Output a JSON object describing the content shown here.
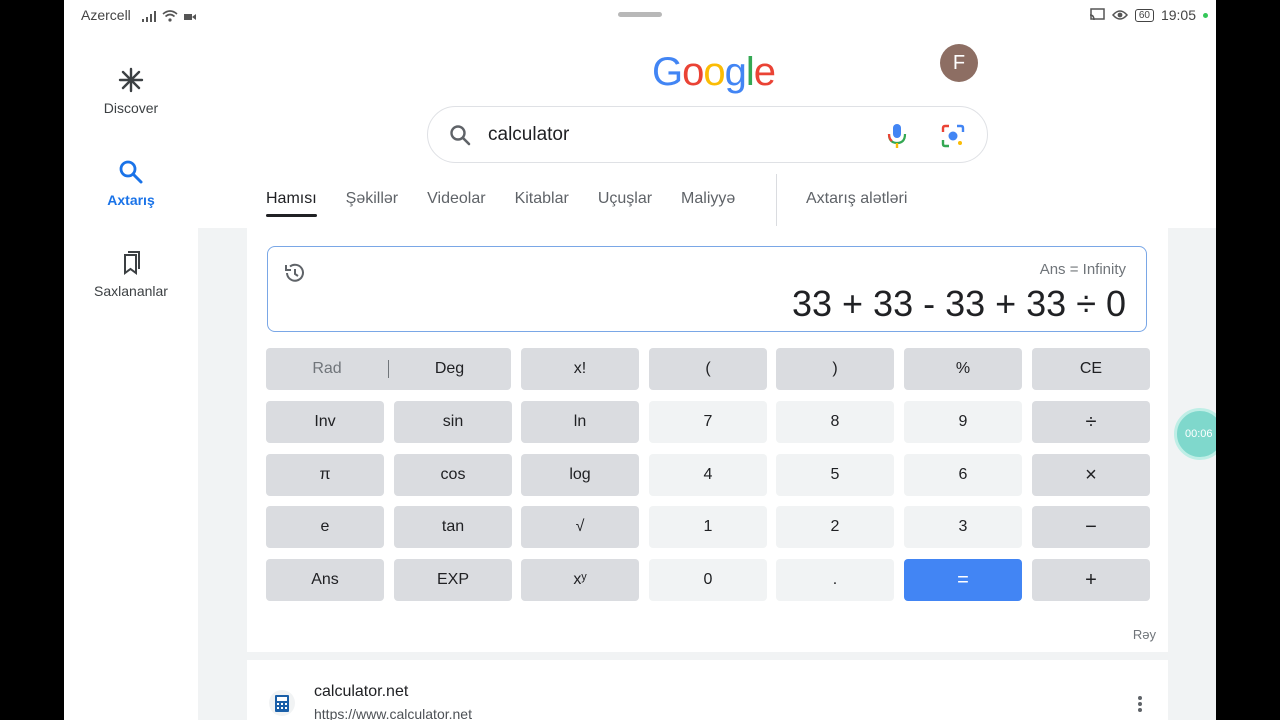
{
  "status_bar": {
    "carrier": "Azercell",
    "battery": "60",
    "time": "19:05"
  },
  "rail": [
    {
      "label": "Discover",
      "icon": "discover-icon"
    },
    {
      "label": "Axtarış",
      "icon": "search-icon",
      "active": true
    },
    {
      "label": "Saxlananlar",
      "icon": "saved-icon"
    }
  ],
  "header": {
    "logo_letters": [
      {
        "ch": "G",
        "color": "#4285f4"
      },
      {
        "ch": "o",
        "color": "#ea4335"
      },
      {
        "ch": "o",
        "color": "#fbbc05"
      },
      {
        "ch": "g",
        "color": "#4285f4"
      },
      {
        "ch": "l",
        "color": "#34a853"
      },
      {
        "ch": "e",
        "color": "#ea4335"
      }
    ],
    "avatar_letter": "F",
    "avatar_color": "#8d6e63"
  },
  "search": {
    "query": "calculator"
  },
  "tabs": [
    "Hamısı",
    "Şəkillər",
    "Videolar",
    "Kitablar",
    "Uçuşlar",
    "Maliyyə"
  ],
  "tools_label": "Axtarış alətləri",
  "calculator": {
    "ans": "Ans = Infinity",
    "expression": "33 + 33 - 33 + 33 ÷ 0",
    "rad_label": "Rad",
    "deg_label": "Deg",
    "keys": [
      {
        "label": "x!",
        "type": "fn",
        "name": "factorial-key"
      },
      {
        "label": "(",
        "type": "fn",
        "name": "open-paren-key"
      },
      {
        "label": ")",
        "type": "fn",
        "name": "close-paren-key"
      },
      {
        "label": "%",
        "type": "fn",
        "name": "percent-key"
      },
      {
        "label": "CE",
        "type": "fn",
        "name": "clear-entry-key"
      },
      {
        "label": "Inv",
        "type": "fn",
        "name": "inv-key"
      },
      {
        "label": "sin",
        "type": "fn",
        "name": "sin-key"
      },
      {
        "label": "ln",
        "type": "fn",
        "name": "ln-key"
      },
      {
        "label": "7",
        "type": "num",
        "name": "digit-7-key"
      },
      {
        "label": "8",
        "type": "num",
        "name": "digit-8-key"
      },
      {
        "label": "9",
        "type": "num",
        "name": "digit-9-key"
      },
      {
        "label": "÷",
        "type": "op",
        "name": "divide-key"
      },
      {
        "label": "π",
        "type": "fn",
        "name": "pi-key"
      },
      {
        "label": "cos",
        "type": "fn",
        "name": "cos-key"
      },
      {
        "label": "log",
        "type": "fn",
        "name": "log-key"
      },
      {
        "label": "4",
        "type": "num",
        "name": "digit-4-key"
      },
      {
        "label": "5",
        "type": "num",
        "name": "digit-5-key"
      },
      {
        "label": "6",
        "type": "num",
        "name": "digit-6-key"
      },
      {
        "label": "×",
        "type": "op",
        "name": "multiply-key"
      },
      {
        "label": "e",
        "type": "fn",
        "name": "e-key"
      },
      {
        "label": "tan",
        "type": "fn",
        "name": "tan-key"
      },
      {
        "label": "√",
        "type": "fn",
        "name": "sqrt-key"
      },
      {
        "label": "1",
        "type": "num",
        "name": "digit-1-key"
      },
      {
        "label": "2",
        "type": "num",
        "name": "digit-2-key"
      },
      {
        "label": "3",
        "type": "num",
        "name": "digit-3-key"
      },
      {
        "label": "−",
        "type": "op",
        "name": "minus-key"
      },
      {
        "label": "Ans",
        "type": "fn",
        "name": "ans-key"
      },
      {
        "label": "EXP",
        "type": "fn",
        "name": "exp-key"
      },
      {
        "label": "xʸ",
        "type": "fn",
        "name": "power-key"
      },
      {
        "label": "0",
        "type": "num",
        "name": "digit-0-key"
      },
      {
        "label": ".",
        "type": "num",
        "name": "decimal-key"
      },
      {
        "label": "=",
        "type": "eq",
        "name": "equals-key"
      },
      {
        "label": "+",
        "type": "op",
        "name": "plus-key"
      }
    ],
    "feedback": "Rəy"
  },
  "result": {
    "site": "calculator.net",
    "url": "https://www.calculator.net"
  },
  "timer": "00:06"
}
